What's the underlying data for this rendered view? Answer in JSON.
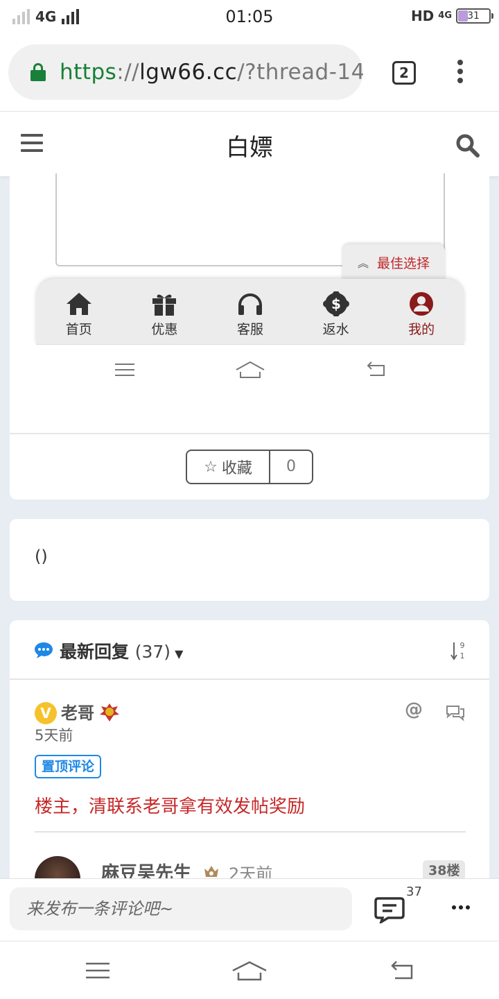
{
  "status_bar": {
    "network": "4G",
    "time": "01:05",
    "hd": "HD",
    "net2": "4G",
    "battery": "31"
  },
  "browser": {
    "url_scheme": "https",
    "url_sep": "://",
    "url_host": "lgw66.cc",
    "url_path": "/?thread-14",
    "tab_count": "2"
  },
  "site": {
    "title": "白嫖"
  },
  "embed": {
    "best_choice": "最佳选择",
    "nav": [
      {
        "label": "首页"
      },
      {
        "label": "优惠"
      },
      {
        "label": "客服"
      },
      {
        "label": "返水"
      },
      {
        "label": "我的"
      }
    ]
  },
  "favorite": {
    "label": "收藏",
    "count": "0"
  },
  "card2": {
    "text": "()"
  },
  "replies": {
    "title": "最新回复",
    "count": "(37)",
    "sort_top": "9",
    "sort_bottom": "1",
    "items": [
      {
        "user": "老哥",
        "badge": "V",
        "time": "5天前",
        "tag": "置顶评论",
        "text": "楼主，清联系老哥拿有效发帖奖励",
        "at": "@"
      },
      {
        "user": "麻豆吴先生",
        "time": "2天前",
        "floor": "38楼"
      }
    ]
  },
  "comment_bar": {
    "placeholder": "来发布一条评论吧~",
    "count": "37"
  },
  "colors": {
    "accent_blue": "#1e88e5",
    "accent_red": "#c62828",
    "lock_green": "#188038"
  }
}
